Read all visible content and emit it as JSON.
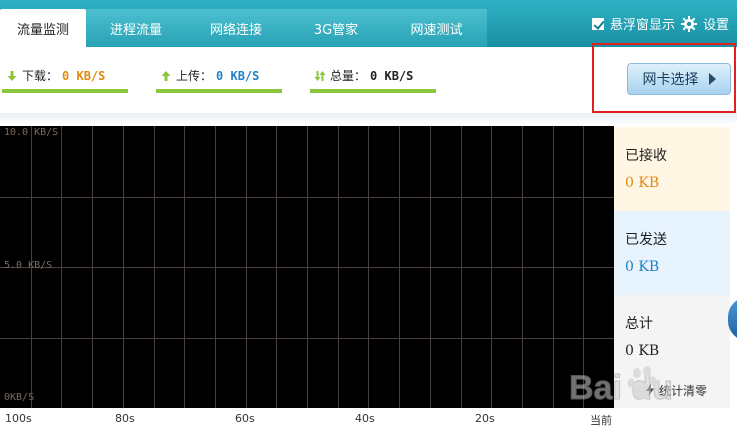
{
  "tabs": [
    {
      "label": "流量监测",
      "active": true
    },
    {
      "label": "进程流量",
      "active": false
    },
    {
      "label": "网络连接",
      "active": false
    },
    {
      "label": "3G管家",
      "active": false
    },
    {
      "label": "网速测试",
      "active": false
    }
  ],
  "top_right": {
    "float_window_label": "悬浮窗显示",
    "float_window_checked": true,
    "settings_label": "设置"
  },
  "stats": {
    "download": {
      "label": "下载：",
      "value": "0 KB/S",
      "color": "#e08a10"
    },
    "upload": {
      "label": "上传：",
      "value": "0 KB/S",
      "color": "#1e82c8"
    },
    "total": {
      "label": "总量：",
      "value": "0 KB/S",
      "color": "#222222"
    }
  },
  "nic_button": {
    "label": "网卡选择"
  },
  "graph": {
    "y_labels": [
      "10.0 KB/S",
      "5.0 KB/S",
      "0KB/S"
    ],
    "x_labels": [
      "100s",
      "80s",
      "60s",
      "40s",
      "20s",
      "当前"
    ]
  },
  "panels": {
    "received": {
      "label": "已接收",
      "value": "0 KB",
      "color": "#e08a10"
    },
    "sent": {
      "label": "已发送",
      "value": "0 KB",
      "color": "#1e82c8"
    },
    "total": {
      "label": "总计",
      "value": "0 KB",
      "color": "#222222"
    },
    "clear_label": "统计清零"
  },
  "watermark": {
    "text": "Bai du"
  }
}
